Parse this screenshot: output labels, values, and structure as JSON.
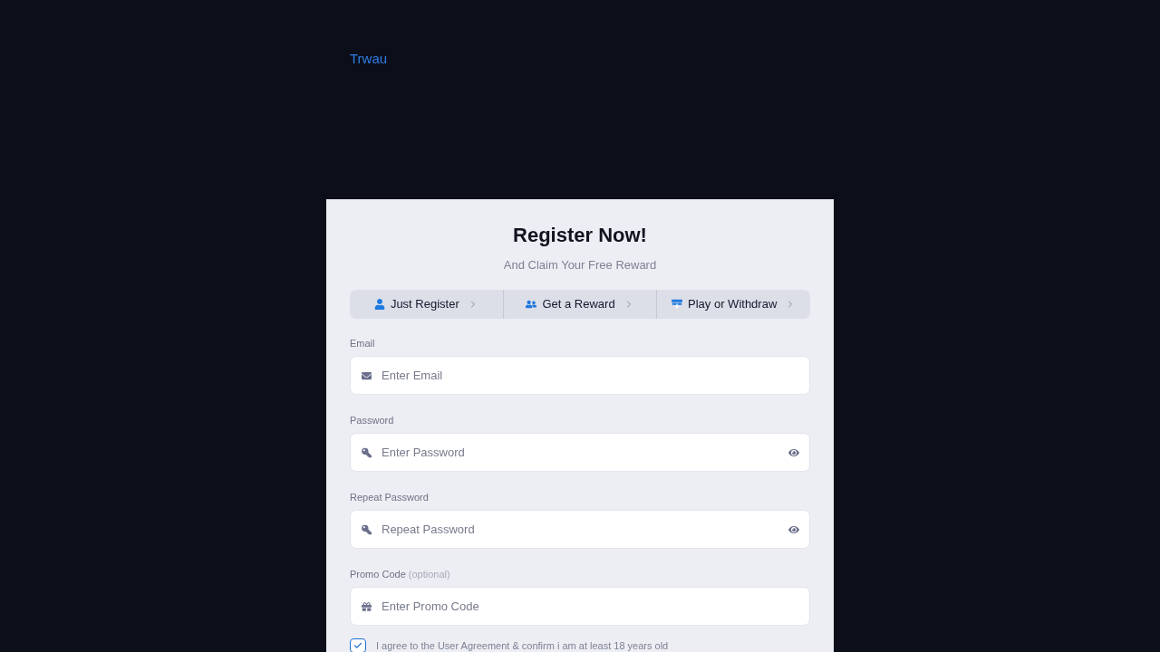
{
  "header": {
    "logo": "Trwau"
  },
  "form": {
    "title": "Register Now!",
    "subtitle": "And Claim Your Free Reward",
    "steps": [
      {
        "kind": "user",
        "label": "Just Register"
      },
      {
        "kind": "reward",
        "label": "Get a Reward"
      },
      {
        "kind": "withdraw",
        "label": "Play or Withdraw"
      }
    ],
    "fields": [
      {
        "kind": "email",
        "label": "Email",
        "placeholder": "Enter Email"
      },
      {
        "kind": "password",
        "label": "Password",
        "placeholder": "Enter Password"
      },
      {
        "kind": "password",
        "label": "Repeat Password",
        "placeholder": "Repeat Password"
      },
      {
        "kind": "promo",
        "label": "Promo Code",
        "note": "(optional)",
        "placeholder": "Enter Promo Code"
      }
    ],
    "agreement": {
      "label": "I agree to the User Agreement & confirm i am at least 18 years old",
      "checked": true
    }
  }
}
